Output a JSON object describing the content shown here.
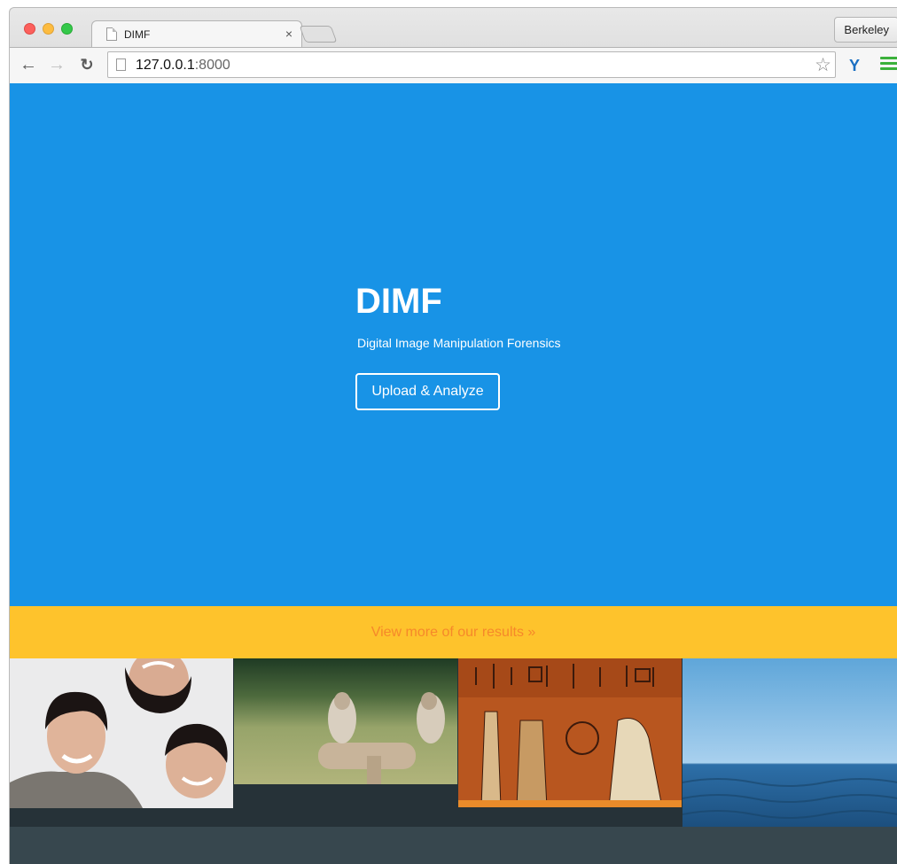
{
  "browser": {
    "tab_title": "DIMF",
    "tab_close": "×",
    "profile_name": "Berkeley",
    "url_host": "127.0.0.1",
    "url_port": ":8000",
    "back_icon": "back-arrow-icon",
    "forward_icon": "forward-arrow-icon",
    "reload_icon": "reload-icon",
    "bookmark_icon": "star-icon",
    "extension_icon": "extension-icon",
    "menu_icon": "hamburger-menu-icon"
  },
  "hero": {
    "title": "DIMF",
    "subtitle": "Digital Image Manipulation Forensics",
    "cta_label": "Upload & Analyze",
    "background": "#1893e6"
  },
  "results_band": {
    "link_text": "View more of our results »",
    "background": "#fec32c",
    "link_color": "#f6882a"
  },
  "gallery": {
    "images": [
      "portrait-faces",
      "falcons-on-perch",
      "egyptian-papyrus",
      "ocean-water"
    ]
  }
}
